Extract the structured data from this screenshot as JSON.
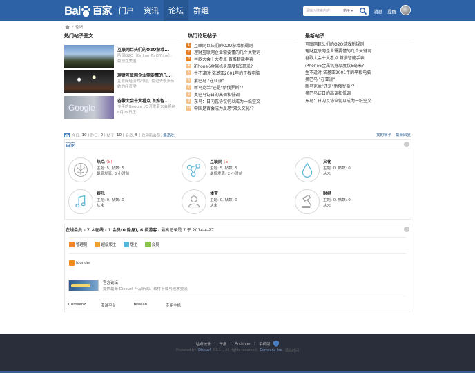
{
  "header": {
    "logo_text": "Bai",
    "logo_suffix": "百家",
    "nav": [
      "门户",
      "资讯",
      "论坛",
      "群组"
    ],
    "active_nav": "论坛",
    "search_placeholder": "请输入搜索内容",
    "search_scope": "帖子",
    "links": [
      "消息",
      "提醒"
    ]
  },
  "breadcrumb": [
    "论坛"
  ],
  "hot_pics": {
    "title": "热门帖子图文",
    "items": [
      {
        "title": "互联网巨头们的O2O游戏...",
        "desc": "所谓O2O（Online To Offline），最初在美国"
      },
      {
        "title": "理财互联网企业需要懂的几...",
        "desc": "互联网经济的出现，使过去很多传统的经济学"
      },
      {
        "title": "谷歌大会十大看点 首推智...",
        "desc": "今年的Google I/O开发者大会将在6月25日正"
      }
    ]
  },
  "hot_topics": {
    "title": "热门论坛帖子",
    "items": [
      "互联网巨头们的O2O游戏新规则",
      "理财互联网企业需要懂的几个关键词",
      "谷歌大会十大看点 首推智能手表",
      "iPhone6金属机身厚度仅6毫米?",
      "生不逢时 诺基亚2001年的平板电脑",
      "素巴马 \"在亚洲\"",
      "新乌克兰\"还是\"新俄罗斯\"？",
      "奥巴马访日的高调和低调",
      "东乌：日内瓦协议何以成为一纸空文",
      "中国是否会成为反恐\"双头文化\"？"
    ]
  },
  "latest": {
    "title": "最新帖子",
    "items": [
      "互联网巨头们的O2O游戏新规则",
      "理财互联网企业需要懂的几个关键词",
      "谷歌大会十大看点 首推智能手表",
      "iPhone6金属机身厚度仅6毫米?",
      "生不逢时 诺基亚2001年的平板电脑",
      "奥巴马 \"在亚洲\"",
      "新乌克兰\"还是\"新俄罗斯\"？",
      "奥巴马访日的高调和低调",
      "东乌：日内瓦协议何以成为一纸空文"
    ]
  },
  "stats": {
    "today_label": "今日:",
    "today": "10",
    "yesterday_label": "昨日:",
    "yesterday": "0",
    "posts_label": "帖子:",
    "posts": "10",
    "members_label": "会员:",
    "members": "5",
    "welcome_label": "欢迎新会员:",
    "new_member": "偶滴吃",
    "my_posts": "我的帖子",
    "latest_reply": "最新回复"
  },
  "category": {
    "name": "百家",
    "forums": [
      {
        "name": "热点",
        "count": "(5)",
        "topics": "主题: 5, 帖数: 5",
        "last": "最后发表: 3 小时前"
      },
      {
        "name": "互联网",
        "count": "(5)",
        "topics": "主题: 5, 帖数: 5",
        "last": "最后发表: 2 小时前"
      },
      {
        "name": "文化",
        "count": "",
        "topics": "主题: 0, 帖数: 0",
        "last": "从未"
      },
      {
        "name": "娱乐",
        "count": "",
        "topics": "主题: 0, 帖数: 0",
        "last": "从未"
      },
      {
        "name": "体育",
        "count": "",
        "topics": "主题: 0, 帖数: 0",
        "last": "从未"
      },
      {
        "name": "财经",
        "count": "",
        "topics": "主题: 0, 帖数: 0",
        "last": "从未"
      }
    ]
  },
  "online": {
    "summary_prefix": "在线会员 - ",
    "summary_main": "7 人在线 - 1 会员(0 隐身), 6 位游客",
    "summary_suffix": " - 最高记录是 7 于 2014-4-27.",
    "groups": [
      "管理员",
      "超级版主",
      "版主",
      "会员"
    ],
    "users": [
      "founder"
    ]
  },
  "links_section": {
    "official_title": "官方论坛",
    "official_desc": "提供最新 Discuz! 产品新闻、软件下载与技术交流",
    "friend_links": [
      "Comsenz",
      "漫游平台",
      "Yeswan",
      "专用主机"
    ]
  },
  "footer": {
    "links": [
      "站点统计",
      "举报",
      "Archiver",
      "手机版"
    ],
    "powered": "Powered by",
    "discuz": "Discuz!",
    "version": "X3.1",
    "rights": ", All rights reserved.",
    "comsenz": "Comsenz Inc.",
    "theme": "源码时间"
  },
  "colors": {
    "brand": "#2d62a6",
    "footer": "#2a2d3a"
  }
}
